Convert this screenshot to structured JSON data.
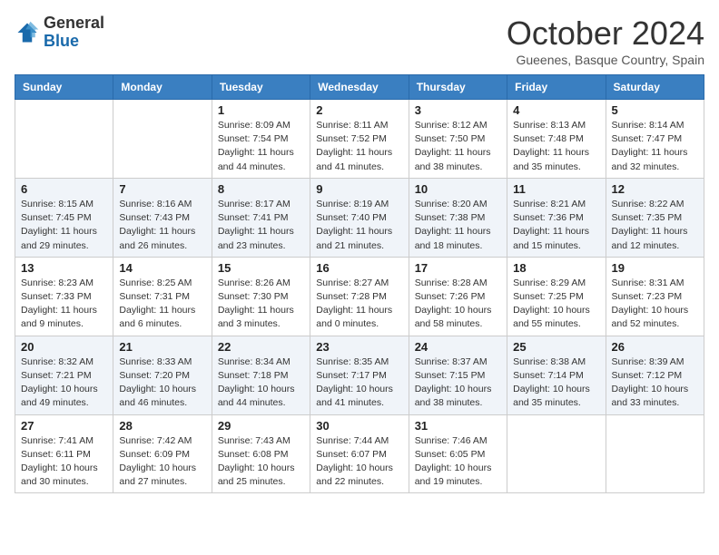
{
  "header": {
    "logo_general": "General",
    "logo_blue": "Blue",
    "month": "October 2024",
    "location": "Gueenes, Basque Country, Spain"
  },
  "weekdays": [
    "Sunday",
    "Monday",
    "Tuesday",
    "Wednesday",
    "Thursday",
    "Friday",
    "Saturday"
  ],
  "weeks": [
    [
      {
        "day": "",
        "info": ""
      },
      {
        "day": "",
        "info": ""
      },
      {
        "day": "1",
        "info": "Sunrise: 8:09 AM\nSunset: 7:54 PM\nDaylight: 11 hours and 44 minutes."
      },
      {
        "day": "2",
        "info": "Sunrise: 8:11 AM\nSunset: 7:52 PM\nDaylight: 11 hours and 41 minutes."
      },
      {
        "day": "3",
        "info": "Sunrise: 8:12 AM\nSunset: 7:50 PM\nDaylight: 11 hours and 38 minutes."
      },
      {
        "day": "4",
        "info": "Sunrise: 8:13 AM\nSunset: 7:48 PM\nDaylight: 11 hours and 35 minutes."
      },
      {
        "day": "5",
        "info": "Sunrise: 8:14 AM\nSunset: 7:47 PM\nDaylight: 11 hours and 32 minutes."
      }
    ],
    [
      {
        "day": "6",
        "info": "Sunrise: 8:15 AM\nSunset: 7:45 PM\nDaylight: 11 hours and 29 minutes."
      },
      {
        "day": "7",
        "info": "Sunrise: 8:16 AM\nSunset: 7:43 PM\nDaylight: 11 hours and 26 minutes."
      },
      {
        "day": "8",
        "info": "Sunrise: 8:17 AM\nSunset: 7:41 PM\nDaylight: 11 hours and 23 minutes."
      },
      {
        "day": "9",
        "info": "Sunrise: 8:19 AM\nSunset: 7:40 PM\nDaylight: 11 hours and 21 minutes."
      },
      {
        "day": "10",
        "info": "Sunrise: 8:20 AM\nSunset: 7:38 PM\nDaylight: 11 hours and 18 minutes."
      },
      {
        "day": "11",
        "info": "Sunrise: 8:21 AM\nSunset: 7:36 PM\nDaylight: 11 hours and 15 minutes."
      },
      {
        "day": "12",
        "info": "Sunrise: 8:22 AM\nSunset: 7:35 PM\nDaylight: 11 hours and 12 minutes."
      }
    ],
    [
      {
        "day": "13",
        "info": "Sunrise: 8:23 AM\nSunset: 7:33 PM\nDaylight: 11 hours and 9 minutes."
      },
      {
        "day": "14",
        "info": "Sunrise: 8:25 AM\nSunset: 7:31 PM\nDaylight: 11 hours and 6 minutes."
      },
      {
        "day": "15",
        "info": "Sunrise: 8:26 AM\nSunset: 7:30 PM\nDaylight: 11 hours and 3 minutes."
      },
      {
        "day": "16",
        "info": "Sunrise: 8:27 AM\nSunset: 7:28 PM\nDaylight: 11 hours and 0 minutes."
      },
      {
        "day": "17",
        "info": "Sunrise: 8:28 AM\nSunset: 7:26 PM\nDaylight: 10 hours and 58 minutes."
      },
      {
        "day": "18",
        "info": "Sunrise: 8:29 AM\nSunset: 7:25 PM\nDaylight: 10 hours and 55 minutes."
      },
      {
        "day": "19",
        "info": "Sunrise: 8:31 AM\nSunset: 7:23 PM\nDaylight: 10 hours and 52 minutes."
      }
    ],
    [
      {
        "day": "20",
        "info": "Sunrise: 8:32 AM\nSunset: 7:21 PM\nDaylight: 10 hours and 49 minutes."
      },
      {
        "day": "21",
        "info": "Sunrise: 8:33 AM\nSunset: 7:20 PM\nDaylight: 10 hours and 46 minutes."
      },
      {
        "day": "22",
        "info": "Sunrise: 8:34 AM\nSunset: 7:18 PM\nDaylight: 10 hours and 44 minutes."
      },
      {
        "day": "23",
        "info": "Sunrise: 8:35 AM\nSunset: 7:17 PM\nDaylight: 10 hours and 41 minutes."
      },
      {
        "day": "24",
        "info": "Sunrise: 8:37 AM\nSunset: 7:15 PM\nDaylight: 10 hours and 38 minutes."
      },
      {
        "day": "25",
        "info": "Sunrise: 8:38 AM\nSunset: 7:14 PM\nDaylight: 10 hours and 35 minutes."
      },
      {
        "day": "26",
        "info": "Sunrise: 8:39 AM\nSunset: 7:12 PM\nDaylight: 10 hours and 33 minutes."
      }
    ],
    [
      {
        "day": "27",
        "info": "Sunrise: 7:41 AM\nSunset: 6:11 PM\nDaylight: 10 hours and 30 minutes."
      },
      {
        "day": "28",
        "info": "Sunrise: 7:42 AM\nSunset: 6:09 PM\nDaylight: 10 hours and 27 minutes."
      },
      {
        "day": "29",
        "info": "Sunrise: 7:43 AM\nSunset: 6:08 PM\nDaylight: 10 hours and 25 minutes."
      },
      {
        "day": "30",
        "info": "Sunrise: 7:44 AM\nSunset: 6:07 PM\nDaylight: 10 hours and 22 minutes."
      },
      {
        "day": "31",
        "info": "Sunrise: 7:46 AM\nSunset: 6:05 PM\nDaylight: 10 hours and 19 minutes."
      },
      {
        "day": "",
        "info": ""
      },
      {
        "day": "",
        "info": ""
      }
    ]
  ]
}
